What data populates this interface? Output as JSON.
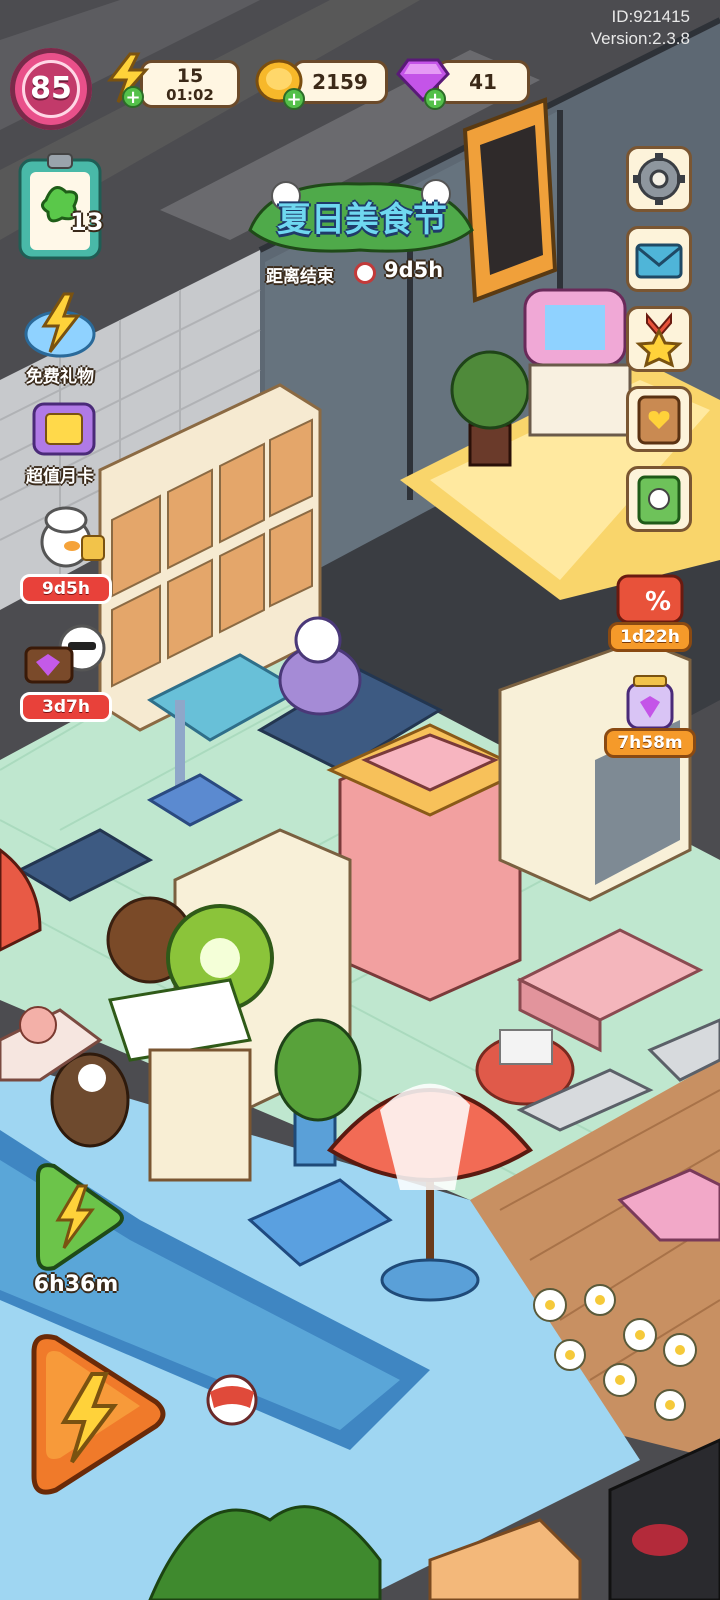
{
  "hud": {
    "id_text": "ID:921415",
    "version_text": "Version:2.3.8",
    "level": "85",
    "energy": {
      "value": "15",
      "timer": "01:02"
    },
    "coins": {
      "value": "2159"
    },
    "gems": {
      "value": "41"
    }
  },
  "tasks": {
    "count": "13"
  },
  "left_menu": {
    "free_gift_label": "免费礼物",
    "monthly_card_label": "超值月卡",
    "chef_offer_1_timer": "9d5h",
    "chef_offer_2_timer": "3d7h"
  },
  "event_banner": {
    "title": "夏日美食节",
    "countdown_label": "距离结束",
    "countdown": "9d5h"
  },
  "right_menu": {
    "sale_timer": "1d22h",
    "jar_timer": "7h58m"
  },
  "bottom": {
    "energy_boost_timer": "6h36m"
  },
  "colors": {
    "level_ring": "#e9508a",
    "plus_green": "#54c04a",
    "timer_orange": "#f59a2a",
    "timer_red": "#e8413a",
    "pool_blue": "#9fd6f2",
    "floor_mint": "#bfe7cf"
  }
}
